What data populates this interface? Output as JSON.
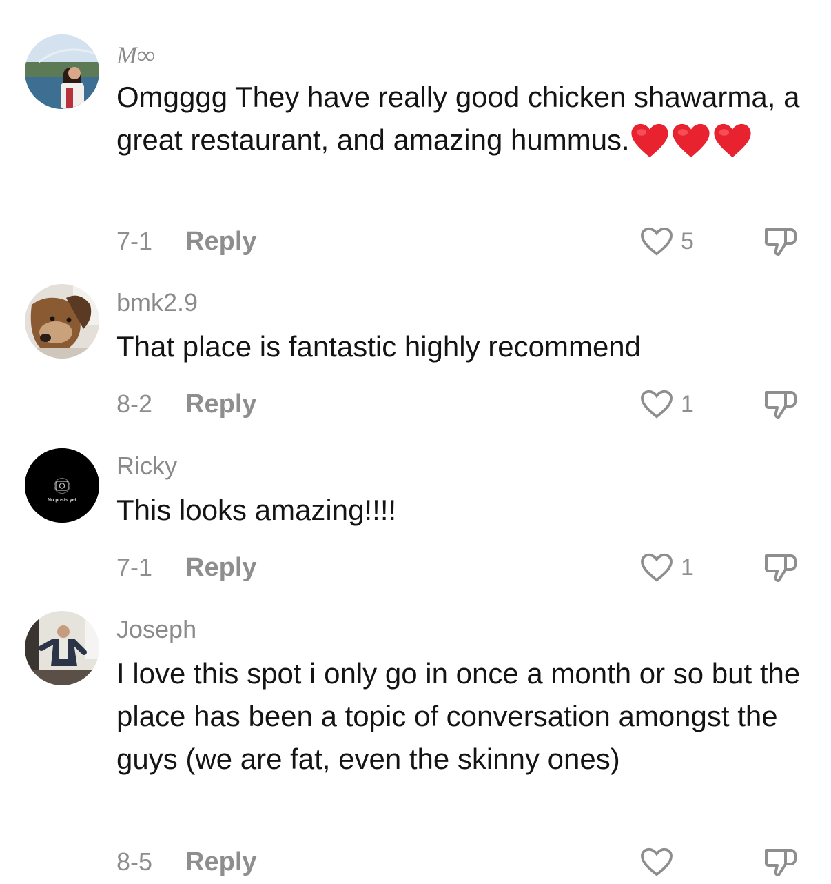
{
  "comments": [
    {
      "username": "M∞",
      "avatar": "lake-bridge-photo",
      "text": "Omgggg They have really good chicken shawarma, a great restaurant, and amazing hummus.",
      "emoji": [
        "red-heart",
        "red-heart",
        "red-heart"
      ],
      "date": "7-1",
      "reply_label": "Reply",
      "likes": "5"
    },
    {
      "username": "bmk2.9",
      "avatar": "dog-photo",
      "text": "That place is fantastic highly recommend",
      "date": "8-2",
      "reply_label": "Reply",
      "likes": "1"
    },
    {
      "username": "Ricky",
      "avatar": "no-posts-yet",
      "avatar_caption": "No posts yet",
      "text": "This looks amazing!!!!",
      "date": "7-1",
      "reply_label": "Reply",
      "likes": "1"
    },
    {
      "username": "Joseph",
      "avatar": "man-dancing-photo",
      "text": "I love this spot i only go in once a month or so but the place has been a topic of conversation amongst the guys (we are fat, even the skinny ones)",
      "date": "8-5",
      "reply_label": "Reply",
      "likes": ""
    }
  ],
  "colors": {
    "meta_gray": "#8e8e8e",
    "text": "#141414",
    "heart_red": "#e8222f"
  }
}
